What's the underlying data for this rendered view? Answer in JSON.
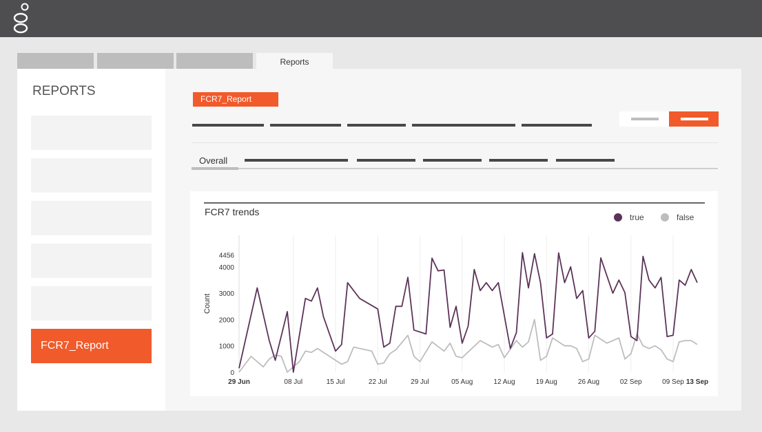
{
  "header": {
    "logo_icon": "genesys-logo-icon"
  },
  "tabs": [
    {
      "label": ""
    },
    {
      "label": ""
    },
    {
      "label": ""
    },
    {
      "label": "Reports"
    }
  ],
  "sidebar": {
    "title": "REPORTS",
    "items": [
      {
        "label": ""
      },
      {
        "label": ""
      },
      {
        "label": ""
      },
      {
        "label": ""
      },
      {
        "label": ""
      },
      {
        "label": "FCR7_Report"
      }
    ]
  },
  "report": {
    "chip_label": "FCR7_Report",
    "subtabs": {
      "active_label": "Overall"
    }
  },
  "colors": {
    "accent": "#f15a2b",
    "series_true": "#5b3358",
    "series_false": "#bdbdbd"
  },
  "chart_data": {
    "type": "line",
    "title": "FCR7 trends",
    "xlabel": "",
    "ylabel": "Count",
    "ylim": [
      0,
      5200
    ],
    "yticks": [
      0,
      1000,
      2000,
      3000,
      4000,
      4456
    ],
    "x_start": "2023-06-29",
    "x_end": "2023-09-13",
    "xtick_labels": [
      "29 Jun",
      "08 Jul",
      "15 Jul",
      "22 Jul",
      "29 Jul",
      "05 Aug",
      "12 Aug",
      "19 Aug",
      "26 Aug",
      "02 Sep",
      "09 Sep",
      "13 Sep"
    ],
    "xtick_dates": [
      "2023-06-29",
      "2023-07-08",
      "2023-07-15",
      "2023-07-22",
      "2023-07-29",
      "2023-08-05",
      "2023-08-12",
      "2023-08-19",
      "2023-08-26",
      "2023-09-02",
      "2023-09-09",
      "2023-09-13"
    ],
    "legend_position": "top-right",
    "grid": true,
    "series": [
      {
        "name": "true",
        "color": "#5b3358",
        "x": [
          "2023-06-29",
          "2023-07-02",
          "2023-07-04",
          "2023-07-05",
          "2023-07-07",
          "2023-07-08",
          "2023-07-10",
          "2023-07-11",
          "2023-07-12",
          "2023-07-13",
          "2023-07-15",
          "2023-07-16",
          "2023-07-17",
          "2023-07-18",
          "2023-07-19",
          "2023-07-22",
          "2023-07-23",
          "2023-07-24",
          "2023-07-25",
          "2023-07-26",
          "2023-07-27",
          "2023-07-28",
          "2023-07-30",
          "2023-07-31",
          "2023-08-01",
          "2023-08-02",
          "2023-08-03",
          "2023-08-04",
          "2023-08-05",
          "2023-08-06",
          "2023-08-07",
          "2023-08-08",
          "2023-08-09",
          "2023-08-10",
          "2023-08-11",
          "2023-08-13",
          "2023-08-14",
          "2023-08-15",
          "2023-08-16",
          "2023-08-17",
          "2023-08-18",
          "2023-08-19",
          "2023-08-20",
          "2023-08-21",
          "2023-08-22",
          "2023-08-23",
          "2023-08-24",
          "2023-08-25",
          "2023-08-26",
          "2023-08-27",
          "2023-08-28",
          "2023-08-30",
          "2023-08-31",
          "2023-09-01",
          "2023-09-02",
          "2023-09-03",
          "2023-09-04",
          "2023-09-05",
          "2023-09-06",
          "2023-09-07",
          "2023-09-08",
          "2023-09-09",
          "2023-09-10",
          "2023-09-11",
          "2023-09-12",
          "2023-09-13"
        ],
        "y": [
          150,
          3200,
          1200,
          450,
          2300,
          0,
          2800,
          2700,
          3200,
          2100,
          800,
          1050,
          3400,
          3100,
          2800,
          2400,
          950,
          1100,
          2500,
          2500,
          3600,
          1600,
          1450,
          4330,
          3850,
          3880,
          1700,
          2500,
          1100,
          1750,
          3900,
          3100,
          3400,
          3100,
          3400,
          900,
          1500,
          4540,
          3200,
          4500,
          3400,
          1300,
          1450,
          4530,
          3400,
          4000,
          2800,
          3100,
          1300,
          1550,
          4340,
          3000,
          3500,
          3020,
          1350,
          1200,
          4400,
          3500,
          3200,
          3600,
          1350,
          1400,
          3500,
          3300,
          3900,
          3400
        ]
      },
      {
        "name": "false",
        "color": "#bdbdbd",
        "x": [
          "2023-06-29",
          "2023-07-01",
          "2023-07-03",
          "2023-07-04",
          "2023-07-05",
          "2023-07-06",
          "2023-07-07",
          "2023-07-09",
          "2023-07-10",
          "2023-07-11",
          "2023-07-12",
          "2023-07-14",
          "2023-07-16",
          "2023-07-17",
          "2023-07-18",
          "2023-07-21",
          "2023-07-22",
          "2023-07-23",
          "2023-07-24",
          "2023-07-25",
          "2023-07-27",
          "2023-07-28",
          "2023-07-29",
          "2023-07-31",
          "2023-08-02",
          "2023-08-03",
          "2023-08-04",
          "2023-08-05",
          "2023-08-08",
          "2023-08-10",
          "2023-08-11",
          "2023-08-12",
          "2023-08-14",
          "2023-08-15",
          "2023-08-16",
          "2023-08-17",
          "2023-08-18",
          "2023-08-19",
          "2023-08-20",
          "2023-08-22",
          "2023-08-23",
          "2023-08-24",
          "2023-08-25",
          "2023-08-26",
          "2023-08-27",
          "2023-08-29",
          "2023-08-31",
          "2023-09-01",
          "2023-09-02",
          "2023-09-03",
          "2023-09-04",
          "2023-09-05",
          "2023-09-06",
          "2023-09-07",
          "2023-09-08",
          "2023-09-09",
          "2023-09-10",
          "2023-09-11",
          "2023-09-12",
          "2023-09-13"
        ],
        "y": [
          0,
          600,
          200,
          500,
          650,
          600,
          0,
          400,
          800,
          750,
          900,
          600,
          300,
          400,
          950,
          800,
          300,
          350,
          700,
          850,
          1400,
          600,
          400,
          1150,
          800,
          1100,
          600,
          550,
          1200,
          950,
          1050,
          550,
          1200,
          950,
          1150,
          2000,
          450,
          600,
          1300,
          1000,
          1000,
          900,
          400,
          500,
          1400,
          1100,
          1300,
          500,
          700,
          1450,
          1000,
          900,
          1000,
          850,
          500,
          400,
          1150,
          1200,
          1200,
          1050
        ]
      }
    ]
  }
}
